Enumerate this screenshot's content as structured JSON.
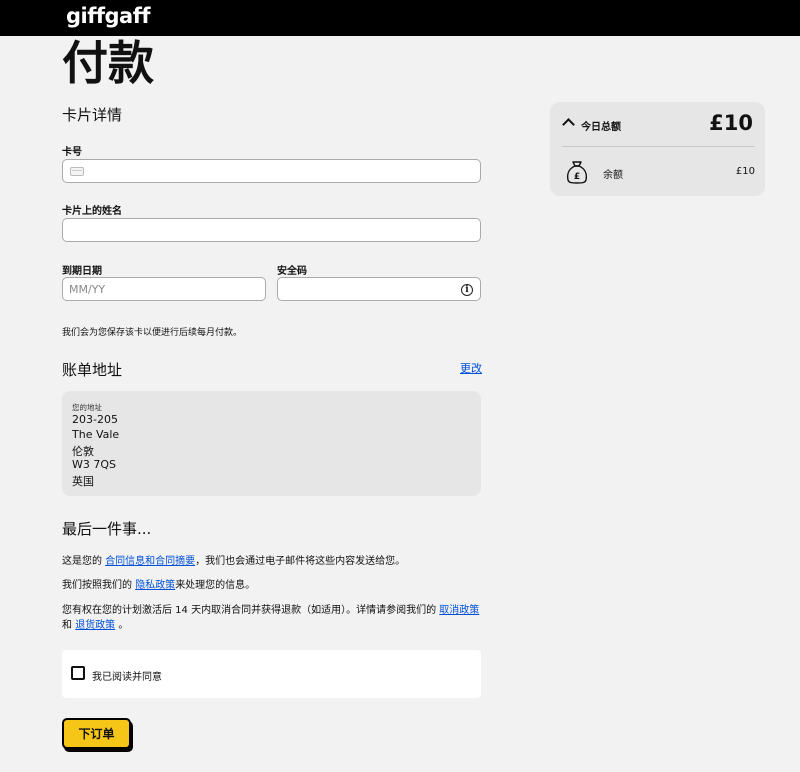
{
  "header": {
    "logo": "giffgaff"
  },
  "page": {
    "title": "付款"
  },
  "card_details": {
    "heading": "卡片详情",
    "card_number": {
      "label": "卡号",
      "value": "",
      "placeholder": ""
    },
    "name_on_card": {
      "label": "卡片上的姓名",
      "value": "",
      "placeholder": ""
    },
    "expiry": {
      "label": "到期日期",
      "value": "",
      "placeholder": "MM/YY"
    },
    "security_code": {
      "label": "安全码",
      "value": "",
      "placeholder": ""
    },
    "save_note": "我们会为您保存该卡以便进行后续每月付款。"
  },
  "billing": {
    "heading": "账单地址",
    "edit_label": "更改",
    "address_label": "您的地址",
    "address_lines": [
      "203-205",
      "The Vale",
      "伦敦",
      "W3 7QS",
      "英国"
    ]
  },
  "final": {
    "heading": "最后一件事...",
    "p1_before": "这是您的 ",
    "p1_link": "合同信息和合同摘要",
    "p1_after": "，我们也会通过电子邮件将这些内容发送给您。",
    "p2_before": "我们按照我们的 ",
    "p2_link": "隐私政策",
    "p2_after": "来处理您的信息。",
    "p3_before": "您有权在您的计划激活后 14 天内取消合同并获得退款（如适用）。详情请参阅我们的 ",
    "p3_link": "取消政策",
    "p4_before": "和 ",
    "p4_link": "退货政策",
    "p4_after": " 。",
    "agree_label": "我已阅读并同意",
    "order_button": "下订单"
  },
  "summary": {
    "today_total_label": "今日总额",
    "today_total_value": "£10",
    "balance_label": "余额",
    "balance_value": "£10"
  },
  "icons": {
    "chevron": "chevron-up-icon",
    "money_bag": "money-bag-icon",
    "info": "info-icon",
    "card": "credit-card-icon"
  },
  "colors": {
    "accent": "#f5c518",
    "link": "#0050d8",
    "header": "#000000"
  }
}
